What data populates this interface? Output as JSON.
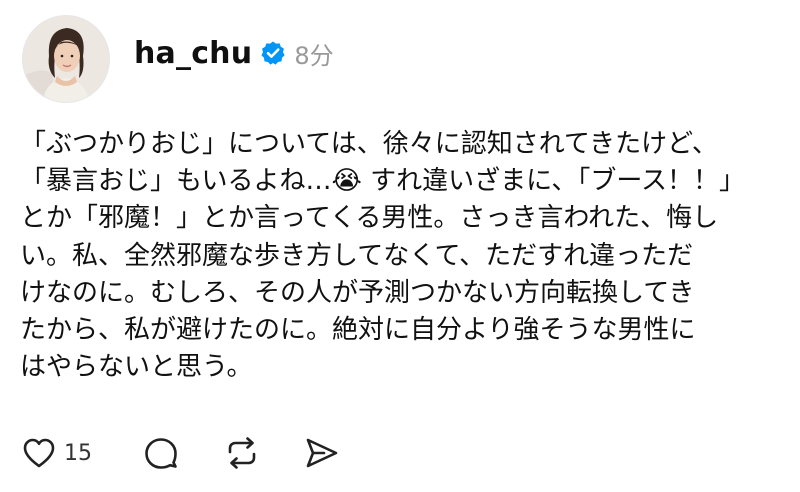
{
  "post": {
    "username": "ha_chu",
    "timestamp": "8分",
    "verified": true,
    "text": "「ぶつかりおじ」については、徐々に認知されてきたけど、\n「暴言おじ」もいるよね…😭 すれ違いざまに、「ブース！！」\nとか「邪魔！」とか言ってくる男性。さっき言われた、悔し\nい。私、全然邪魔な歩き方してなくて、ただすれ違っただ\nけなのに。むしろ、その人が予測つかない方向転換してき\nたから、私が避けたのに。絶対に自分より強そうな男性に\nはやらないと思う。",
    "like_count": "15"
  },
  "icons": {
    "verified": "verified-badge-icon",
    "like": "heart-icon",
    "reply": "comment-bubble-icon",
    "repost": "repost-icon",
    "share": "send-icon"
  },
  "colors": {
    "verified_badge": "#0095f6",
    "timestamp": "#999999",
    "text": "#111111",
    "icon": "#222222"
  }
}
